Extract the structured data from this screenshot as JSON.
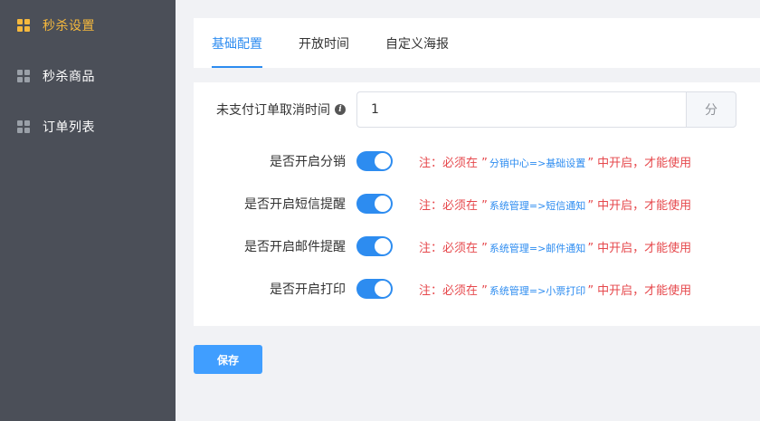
{
  "sidebar": {
    "items": [
      {
        "label": "秒杀设置",
        "active": true
      },
      {
        "label": "秒杀商品",
        "active": false
      },
      {
        "label": "订单列表",
        "active": false
      }
    ]
  },
  "tabs": [
    {
      "label": "基础配置",
      "active": true
    },
    {
      "label": "开放时间",
      "active": false
    },
    {
      "label": "自定义海报",
      "active": false
    }
  ],
  "form": {
    "cancel_time": {
      "label": "未支付订单取消时间",
      "value": "1",
      "unit": "分"
    },
    "switches": [
      {
        "label": "是否开启分销",
        "on": true,
        "note_prefix": "注：必须在 ”",
        "note_path": "分销中心=>基础设置",
        "note_suffix": "” 中开启，才能使用"
      },
      {
        "label": "是否开启短信提醒",
        "on": true,
        "note_prefix": "注：必须在 ”",
        "note_path": "系统管理=>短信通知",
        "note_suffix": "” 中开启，才能使用"
      },
      {
        "label": "是否开启邮件提醒",
        "on": true,
        "note_prefix": "注：必须在 ”",
        "note_path": "系统管理=>邮件通知",
        "note_suffix": "” 中开启，才能使用"
      },
      {
        "label": "是否开启打印",
        "on": true,
        "note_prefix": "注：必须在 ”",
        "note_path": "系统管理=>小票打印",
        "note_suffix": "” 中开启，才能使用"
      }
    ]
  },
  "save_label": "保存",
  "colors": {
    "accent": "#2d8cf0",
    "sidebar_active": "#f5b83d",
    "warning": "#e6484c"
  }
}
